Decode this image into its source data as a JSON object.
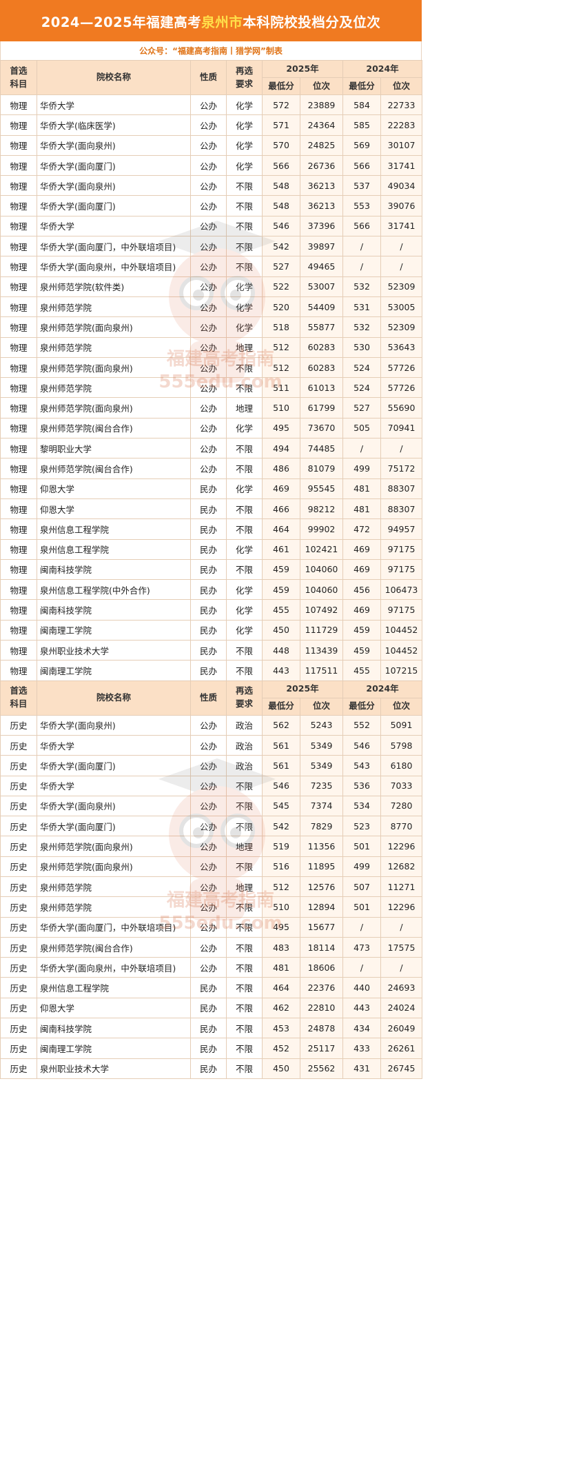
{
  "title": {
    "prefix": "2024—2025年福建高考",
    "highlight": "泉州市",
    "suffix": "本科院校投档分及位次"
  },
  "subtitle": "公众号：“福建高考指南丨猎学网”制表",
  "watermark": {
    "line1": "福建高考指南",
    "line2": "555edu.com"
  },
  "header": {
    "category": "首选\n科目",
    "category_l1": "首选",
    "category_l2": "科目",
    "school": "院校名称",
    "type": "性质",
    "req_l1": "再选",
    "req_l2": "要求",
    "year_2025": "2025年",
    "year_2024": "2024年",
    "min_score": "最低分",
    "rank": "位次"
  },
  "physics_rows": [
    [
      "物理",
      "华侨大学",
      "公办",
      "化学",
      "572",
      "23889",
      "584",
      "22733"
    ],
    [
      "物理",
      "华侨大学(临床医学)",
      "公办",
      "化学",
      "571",
      "24364",
      "585",
      "22283"
    ],
    [
      "物理",
      "华侨大学(面向泉州)",
      "公办",
      "化学",
      "570",
      "24825",
      "569",
      "30107"
    ],
    [
      "物理",
      "华侨大学(面向厦门)",
      "公办",
      "化学",
      "566",
      "26736",
      "566",
      "31741"
    ],
    [
      "物理",
      "华侨大学(面向泉州)",
      "公办",
      "不限",
      "548",
      "36213",
      "537",
      "49034"
    ],
    [
      "物理",
      "华侨大学(面向厦门)",
      "公办",
      "不限",
      "548",
      "36213",
      "553",
      "39076"
    ],
    [
      "物理",
      "华侨大学",
      "公办",
      "不限",
      "546",
      "37396",
      "566",
      "31741"
    ],
    [
      "物理",
      "华侨大学(面向厦门，中外联培项目)",
      "公办",
      "不限",
      "542",
      "39897",
      "/",
      "/"
    ],
    [
      "物理",
      "华侨大学(面向泉州，中外联培项目)",
      "公办",
      "不限",
      "527",
      "49465",
      "/",
      "/"
    ],
    [
      "物理",
      "泉州师范学院(软件类)",
      "公办",
      "化学",
      "522",
      "53007",
      "532",
      "52309"
    ],
    [
      "物理",
      "泉州师范学院",
      "公办",
      "化学",
      "520",
      "54409",
      "531",
      "53005"
    ],
    [
      "物理",
      "泉州师范学院(面向泉州)",
      "公办",
      "化学",
      "518",
      "55877",
      "532",
      "52309"
    ],
    [
      "物理",
      "泉州师范学院",
      "公办",
      "地理",
      "512",
      "60283",
      "530",
      "53643"
    ],
    [
      "物理",
      "泉州师范学院(面向泉州)",
      "公办",
      "不限",
      "512",
      "60283",
      "524",
      "57726"
    ],
    [
      "物理",
      "泉州师范学院",
      "公办",
      "不限",
      "511",
      "61013",
      "524",
      "57726"
    ],
    [
      "物理",
      "泉州师范学院(面向泉州)",
      "公办",
      "地理",
      "510",
      "61799",
      "527",
      "55690"
    ],
    [
      "物理",
      "泉州师范学院(闽台合作)",
      "公办",
      "化学",
      "495",
      "73670",
      "505",
      "70941"
    ],
    [
      "物理",
      "黎明职业大学",
      "公办",
      "不限",
      "494",
      "74485",
      "/",
      "/"
    ],
    [
      "物理",
      "泉州师范学院(闽台合作)",
      "公办",
      "不限",
      "486",
      "81079",
      "499",
      "75172"
    ],
    [
      "物理",
      "仰恩大学",
      "民办",
      "化学",
      "469",
      "95545",
      "481",
      "88307"
    ],
    [
      "物理",
      "仰恩大学",
      "民办",
      "不限",
      "466",
      "98212",
      "481",
      "88307"
    ],
    [
      "物理",
      "泉州信息工程学院",
      "民办",
      "不限",
      "464",
      "99902",
      "472",
      "94957"
    ],
    [
      "物理",
      "泉州信息工程学院",
      "民办",
      "化学",
      "461",
      "102421",
      "469",
      "97175"
    ],
    [
      "物理",
      "闽南科技学院",
      "民办",
      "不限",
      "459",
      "104060",
      "469",
      "97175"
    ],
    [
      "物理",
      "泉州信息工程学院(中外合作)",
      "民办",
      "化学",
      "459",
      "104060",
      "456",
      "106473"
    ],
    [
      "物理",
      "闽南科技学院",
      "民办",
      "化学",
      "455",
      "107492",
      "469",
      "97175"
    ],
    [
      "物理",
      "闽南理工学院",
      "民办",
      "化学",
      "450",
      "111729",
      "459",
      "104452"
    ],
    [
      "物理",
      "泉州职业技术大学",
      "民办",
      "不限",
      "448",
      "113439",
      "459",
      "104452"
    ],
    [
      "物理",
      "闽南理工学院",
      "民办",
      "不限",
      "443",
      "117511",
      "455",
      "107215"
    ]
  ],
  "history_rows": [
    [
      "历史",
      "华侨大学(面向泉州)",
      "公办",
      "政治",
      "562",
      "5243",
      "552",
      "5091"
    ],
    [
      "历史",
      "华侨大学",
      "公办",
      "政治",
      "561",
      "5349",
      "546",
      "5798"
    ],
    [
      "历史",
      "华侨大学(面向厦门)",
      "公办",
      "政治",
      "561",
      "5349",
      "543",
      "6180"
    ],
    [
      "历史",
      "华侨大学",
      "公办",
      "不限",
      "546",
      "7235",
      "536",
      "7033"
    ],
    [
      "历史",
      "华侨大学(面向泉州)",
      "公办",
      "不限",
      "545",
      "7374",
      "534",
      "7280"
    ],
    [
      "历史",
      "华侨大学(面向厦门)",
      "公办",
      "不限",
      "542",
      "7829",
      "523",
      "8770"
    ],
    [
      "历史",
      "泉州师范学院(面向泉州)",
      "公办",
      "地理",
      "519",
      "11356",
      "501",
      "12296"
    ],
    [
      "历史",
      "泉州师范学院(面向泉州)",
      "公办",
      "不限",
      "516",
      "11895",
      "499",
      "12682"
    ],
    [
      "历史",
      "泉州师范学院",
      "公办",
      "地理",
      "512",
      "12576",
      "507",
      "11271"
    ],
    [
      "历史",
      "泉州师范学院",
      "公办",
      "不限",
      "510",
      "12894",
      "501",
      "12296"
    ],
    [
      "历史",
      "华侨大学(面向厦门，中外联培项目)",
      "公办",
      "不限",
      "495",
      "15677",
      "/",
      "/"
    ],
    [
      "历史",
      "泉州师范学院(闽台合作)",
      "公办",
      "不限",
      "483",
      "18114",
      "473",
      "17575"
    ],
    [
      "历史",
      "华侨大学(面向泉州，中外联培项目)",
      "公办",
      "不限",
      "481",
      "18606",
      "/",
      "/"
    ],
    [
      "历史",
      "泉州信息工程学院",
      "民办",
      "不限",
      "464",
      "22376",
      "440",
      "24693"
    ],
    [
      "历史",
      "仰恩大学",
      "民办",
      "不限",
      "462",
      "22810",
      "443",
      "24024"
    ],
    [
      "历史",
      "闽南科技学院",
      "民办",
      "不限",
      "453",
      "24878",
      "434",
      "26049"
    ],
    [
      "历史",
      "闽南理工学院",
      "民办",
      "不限",
      "452",
      "25117",
      "433",
      "26261"
    ],
    [
      "历史",
      "泉州职业技术大学",
      "民办",
      "不限",
      "450",
      "25562",
      "431",
      "26745"
    ]
  ]
}
